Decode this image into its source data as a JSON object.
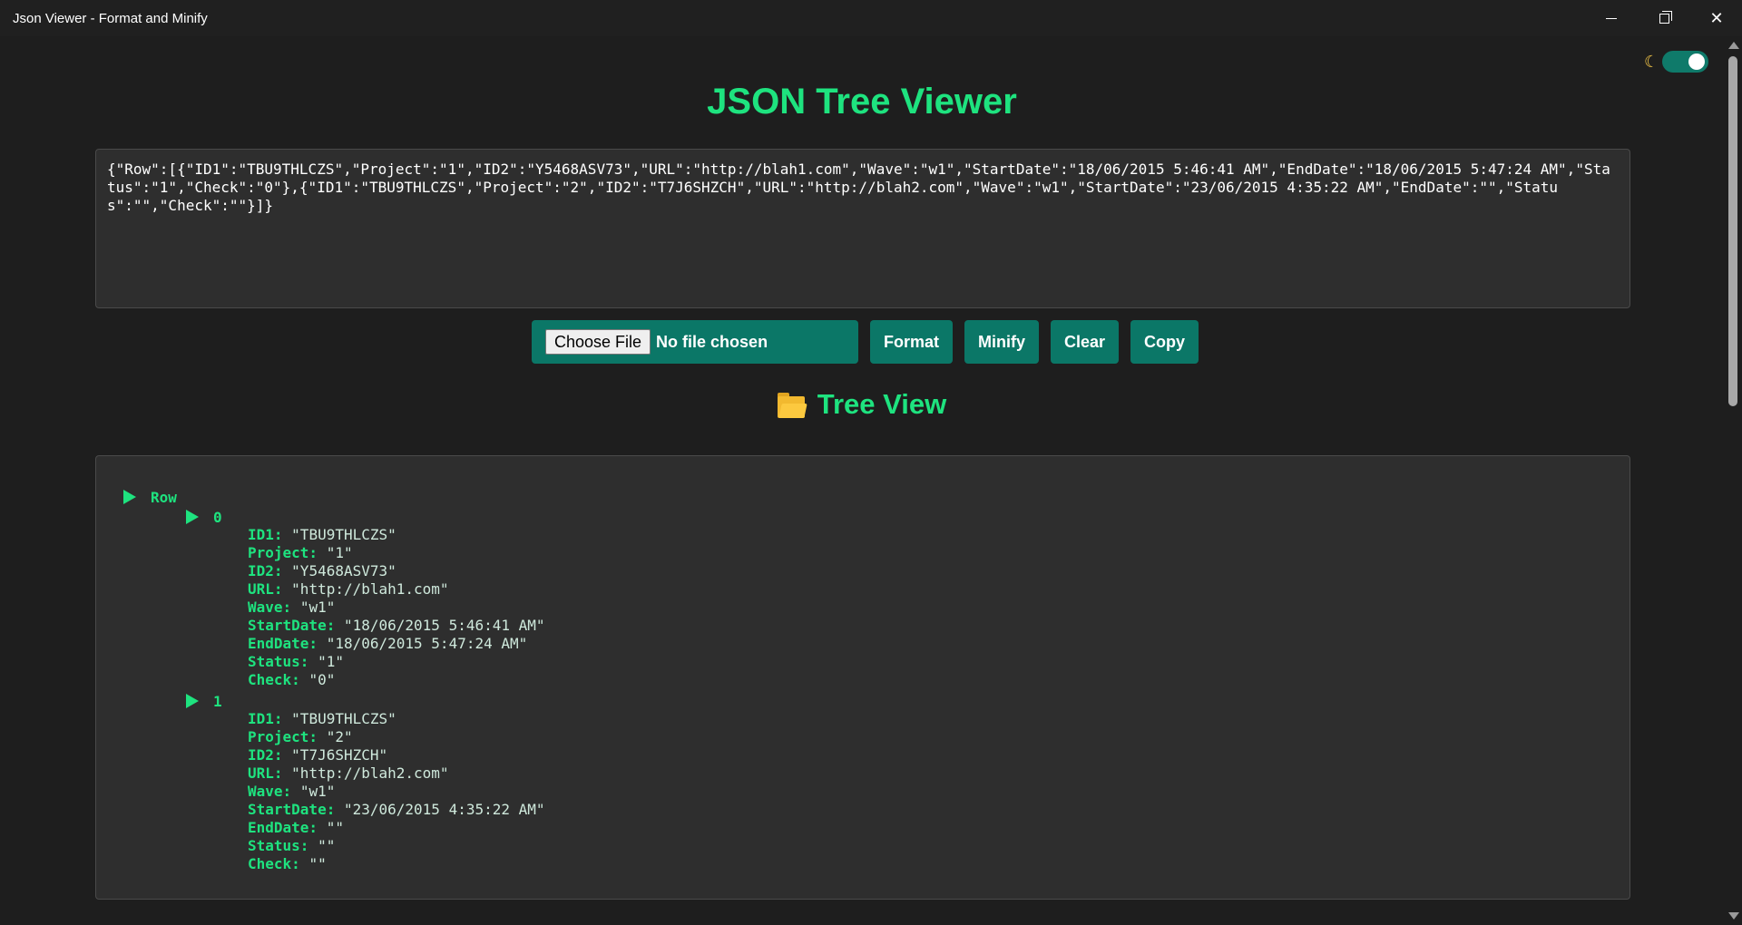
{
  "window": {
    "title": "Json Viewer - Format and Minify"
  },
  "theme_toggle": {
    "icon": "moon-icon",
    "on": true
  },
  "app_title": "JSON Tree Viewer",
  "json_input": {
    "value": "{\"Row\":[{\"ID1\":\"TBU9THLCZS\",\"Project\":\"1\",\"ID2\":\"Y5468ASV73\",\"URL\":\"http://blah1.com\",\"Wave\":\"w1\",\"StartDate\":\"18/06/2015 5:46:41 AM\",\"EndDate\":\"18/06/2015 5:47:24 AM\",\"Status\":\"1\",\"Check\":\"0\"},{\"ID1\":\"TBU9THLCZS\",\"Project\":\"2\",\"ID2\":\"T7J6SHZCH\",\"URL\":\"http://blah2.com\",\"Wave\":\"w1\",\"StartDate\":\"23/06/2015 4:35:22 AM\",\"EndDate\":\"\",\"Status\":\"\",\"Check\":\"\"}]}"
  },
  "controls": {
    "choose_file_label": "Choose File",
    "file_status": "No file chosen",
    "format_label": "Format",
    "minify_label": "Minify",
    "clear_label": "Clear",
    "copy_label": "Copy"
  },
  "tree_view": {
    "heading": "Tree View",
    "heading_icon": "folder-icon",
    "root_key": "Row",
    "items": [
      {
        "index": "0",
        "fields": [
          {
            "key": "ID1:",
            "value": "\"TBU9THLCZS\""
          },
          {
            "key": "Project:",
            "value": "\"1\""
          },
          {
            "key": "ID2:",
            "value": "\"Y5468ASV73\""
          },
          {
            "key": "URL:",
            "value": "\"http://blah1.com\""
          },
          {
            "key": "Wave:",
            "value": "\"w1\""
          },
          {
            "key": "StartDate:",
            "value": "\"18/06/2015 5:46:41 AM\""
          },
          {
            "key": "EndDate:",
            "value": "\"18/06/2015 5:47:24 AM\""
          },
          {
            "key": "Status:",
            "value": "\"1\""
          },
          {
            "key": "Check:",
            "value": "\"0\""
          }
        ]
      },
      {
        "index": "1",
        "fields": [
          {
            "key": "ID1:",
            "value": "\"TBU9THLCZS\""
          },
          {
            "key": "Project:",
            "value": "\"2\""
          },
          {
            "key": "ID2:",
            "value": "\"T7J6SHZCH\""
          },
          {
            "key": "URL:",
            "value": "\"http://blah2.com\""
          },
          {
            "key": "Wave:",
            "value": "\"w1\""
          },
          {
            "key": "StartDate:",
            "value": "\"23/06/2015 4:35:22 AM\""
          },
          {
            "key": "EndDate:",
            "value": "\"\""
          },
          {
            "key": "Status:",
            "value": "\"\""
          },
          {
            "key": "Check:",
            "value": "\"\""
          }
        ]
      }
    ]
  },
  "colors": {
    "accent": "#1ee37f",
    "button": "#0b7767",
    "background": "#1e1e1e",
    "panel": "#2e2e2e"
  }
}
